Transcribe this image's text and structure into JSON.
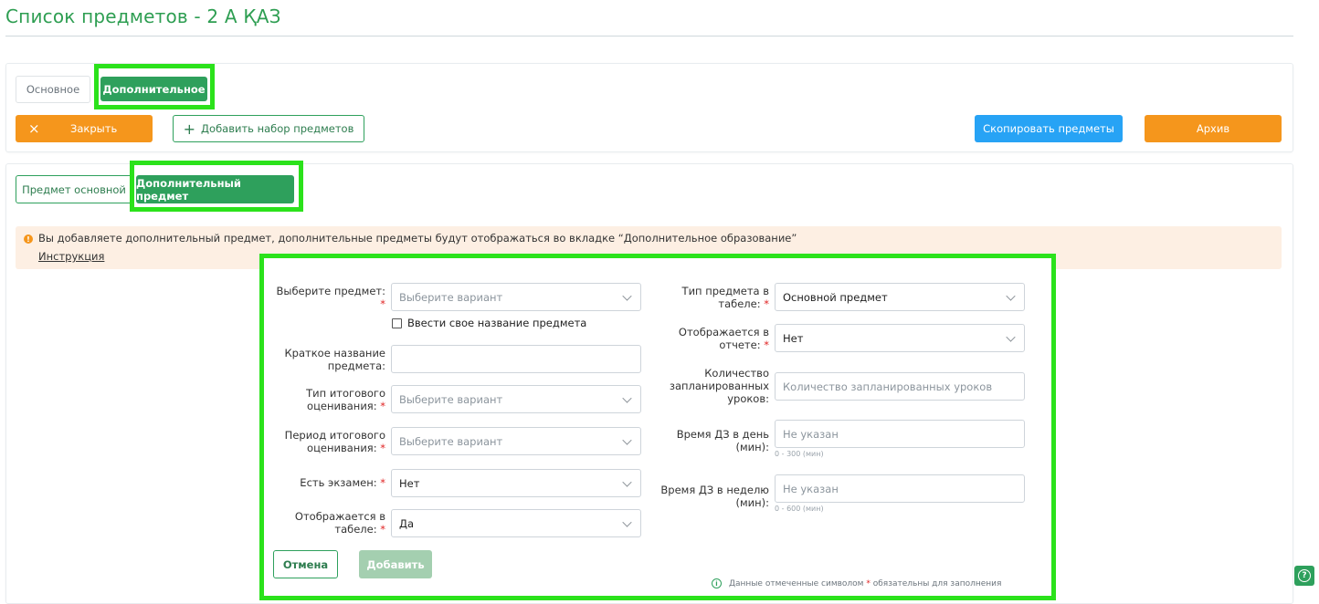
{
  "page": {
    "title": "Список предметов - 2 А ҚАЗ"
  },
  "tabs": {
    "basic": "Основное",
    "extra": "Дополнительное"
  },
  "toolbar": {
    "close_label": "Закрыть",
    "close_icon": "×",
    "add_set_icon": "+",
    "add_set_label": "Добавить набор предметов",
    "copy_label": "Скопировать предметы",
    "archive_label": "Архив"
  },
  "subtabs": {
    "basic": "Предмет основной",
    "extra": "Дополнительный предмет"
  },
  "notice": {
    "text": "Вы добавляете дополнительный предмет, дополнительные предметы будут отображаться во вкладке “Дополнительное образование”",
    "link": "Инструкция"
  },
  "form": {
    "required_mark": "*",
    "left": {
      "subject_label": "Выберите предмет:",
      "subject_placeholder": "Выберите вариант",
      "custom_name_label": "Ввести свое название предмета",
      "short_name_label": "Краткое название предмета:",
      "short_name_value": "",
      "final_type_label": "Тип итогового оценивания:",
      "final_type_placeholder": "Выберите вариант",
      "final_period_label": "Период итогового оценивания:",
      "final_period_placeholder": "Выберите вариант",
      "exam_label": "Есть экзамен:",
      "exam_value": "Нет",
      "in_table_label": "Отображается в табеле:",
      "in_table_value": "Да"
    },
    "right": {
      "table_type_label": "Тип предмета в табеле:",
      "table_type_value": "Основной предмет",
      "in_report_label": "Отображается в отчете:",
      "in_report_value": "Нет",
      "planned_lessons_label": "Количество запланированных уроков:",
      "planned_lessons_placeholder": "Количество запланированных уроков",
      "hw_day_label": "Время ДЗ в день (мин):",
      "hw_day_placeholder": "Не указан",
      "hw_day_hint": "0 - 300 (мин)",
      "hw_week_label": "Время ДЗ в неделю (мин):",
      "hw_week_placeholder": "Не указан",
      "hw_week_hint": "0 - 600 (мин)"
    },
    "cancel_label": "Отмена",
    "submit_label": "Добавить",
    "footnote_before": "Данные отмеченные символом",
    "footnote_after": "обязательны для заполнения"
  },
  "colors": {
    "accent_green": "#2ea05c",
    "orange": "#f5961c",
    "blue": "#27a3f5",
    "highlight": "#2be21b"
  },
  "icons": {
    "close": "close-icon",
    "add": "plus-icon",
    "chevron": "chevron-down-icon",
    "help": "help-icon",
    "info": "info-icon"
  }
}
